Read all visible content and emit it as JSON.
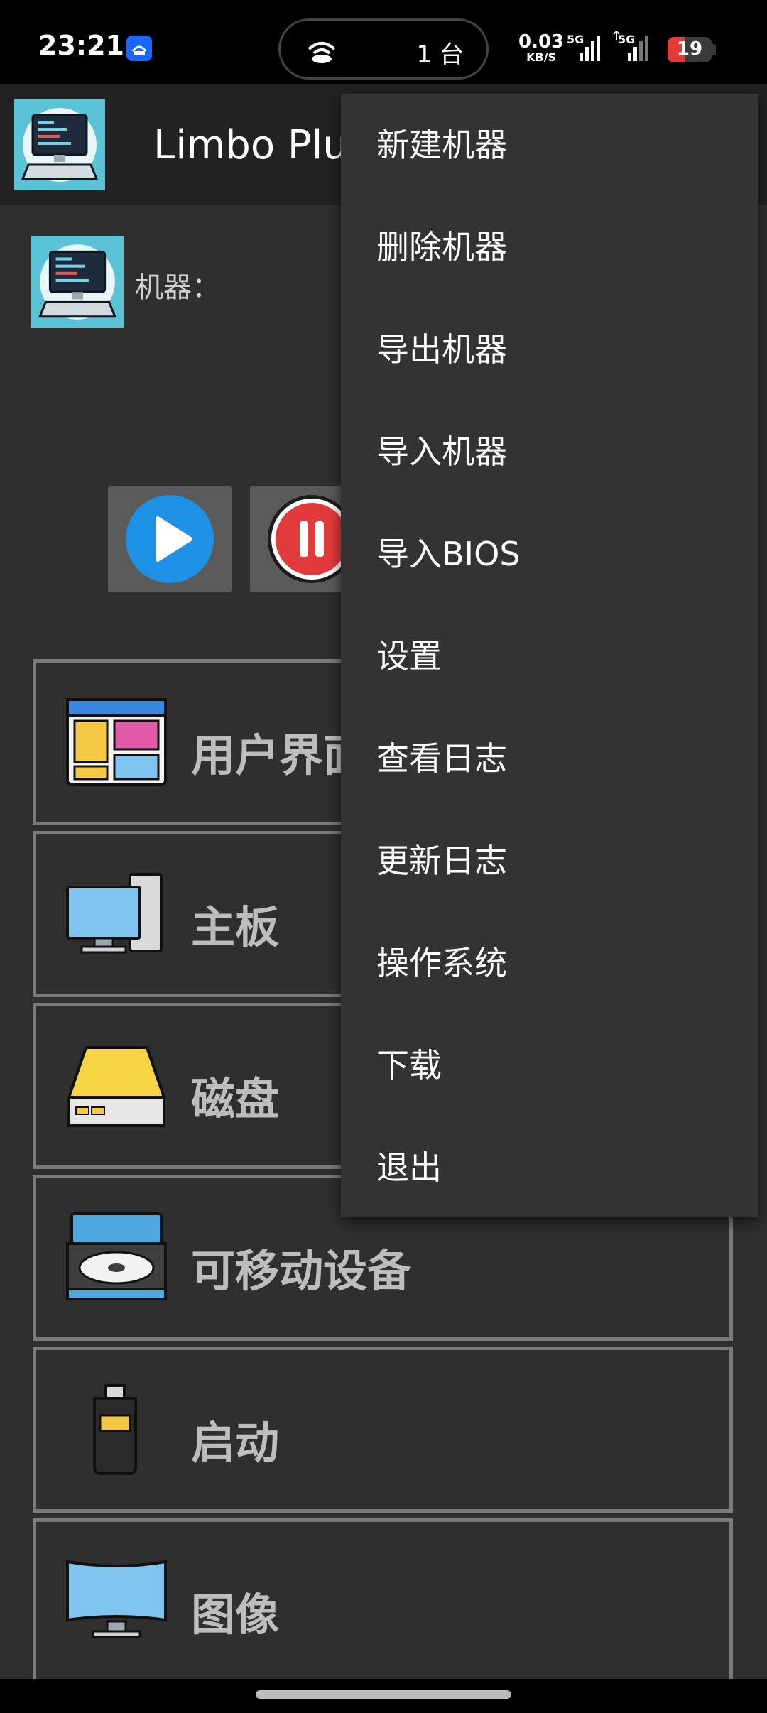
{
  "status_bar": {
    "time": "23:21",
    "hotspot_count": "1 台",
    "net_speed": "0.03",
    "net_speed_unit": "KB/S",
    "signal1_label": "5G",
    "signal2_label": "5G",
    "battery_level": "19",
    "colors": {
      "battery_low": "#e23a36",
      "app_badge": "#1a66ff"
    }
  },
  "app_bar": {
    "title": "Limbo Plus"
  },
  "machine": {
    "label": "机器："
  },
  "controls": {
    "start_icon": "play-circle-icon",
    "pause_icon": "pause-circle-icon"
  },
  "sections": [
    {
      "label": "用户界面",
      "icon": "ui-window-icon"
    },
    {
      "label": "主板",
      "icon": "desktop-computer-icon"
    },
    {
      "label": "磁盘",
      "icon": "hard-disk-icon"
    },
    {
      "label": "可移动设备",
      "icon": "cd-drive-icon"
    },
    {
      "label": "启动",
      "icon": "usb-drive-icon"
    },
    {
      "label": "图像",
      "icon": "monitor-icon"
    }
  ],
  "menu": {
    "items": [
      "新建机器",
      "删除机器",
      "导出机器",
      "导入机器",
      "导入BIOS",
      "设置",
      "查看日志",
      "更新日志",
      "操作系统",
      "下载",
      "退出"
    ]
  }
}
